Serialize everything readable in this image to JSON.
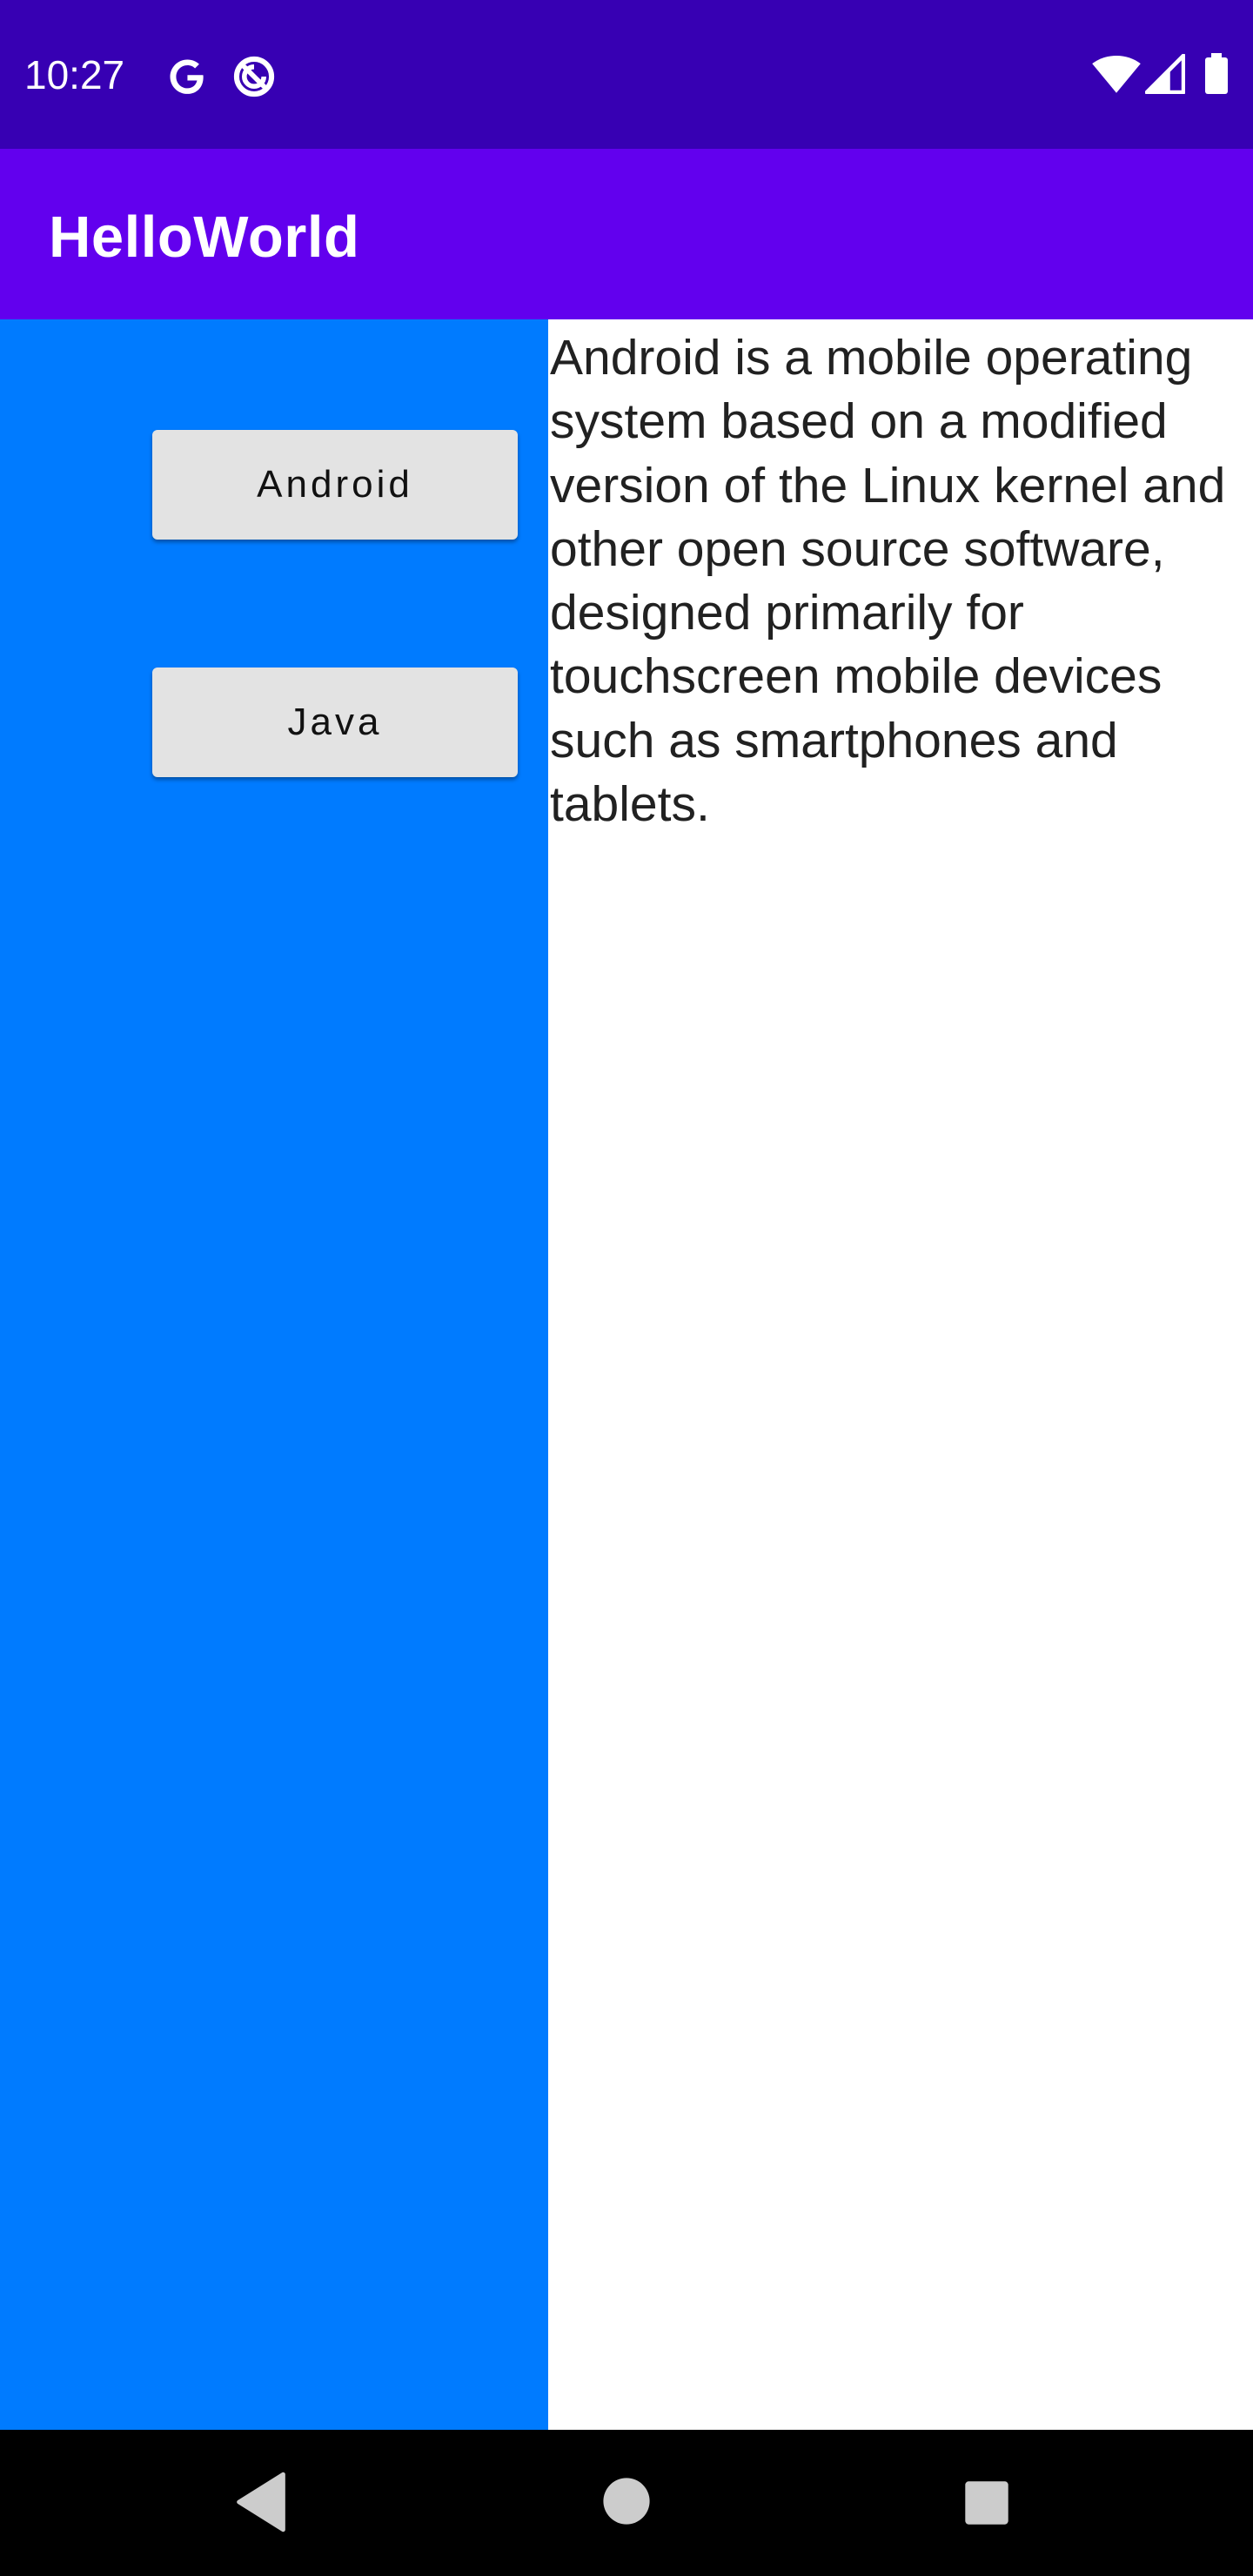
{
  "status_bar": {
    "time": "10:27",
    "left_icons": [
      "google-g-icon",
      "sync-off-icon"
    ],
    "right_icons": [
      "wifi-icon",
      "cell-signal-icon",
      "battery-icon"
    ],
    "background": "#3700B3"
  },
  "app_bar": {
    "title": "HelloWorld",
    "background": "#6200EE"
  },
  "left_panel": {
    "background": "#007BFF",
    "buttons": [
      {
        "label": "Android"
      },
      {
        "label": "Java"
      }
    ]
  },
  "detail": {
    "text": "Android is a mobile operating system based on a modified version of the Linux kernel and other open source software, designed primarily for touchscreen mobile devices such as smartphones and tablets."
  },
  "nav_bar": {
    "icons": [
      "back-icon",
      "home-icon",
      "recents-icon"
    ],
    "background": "#000000"
  }
}
